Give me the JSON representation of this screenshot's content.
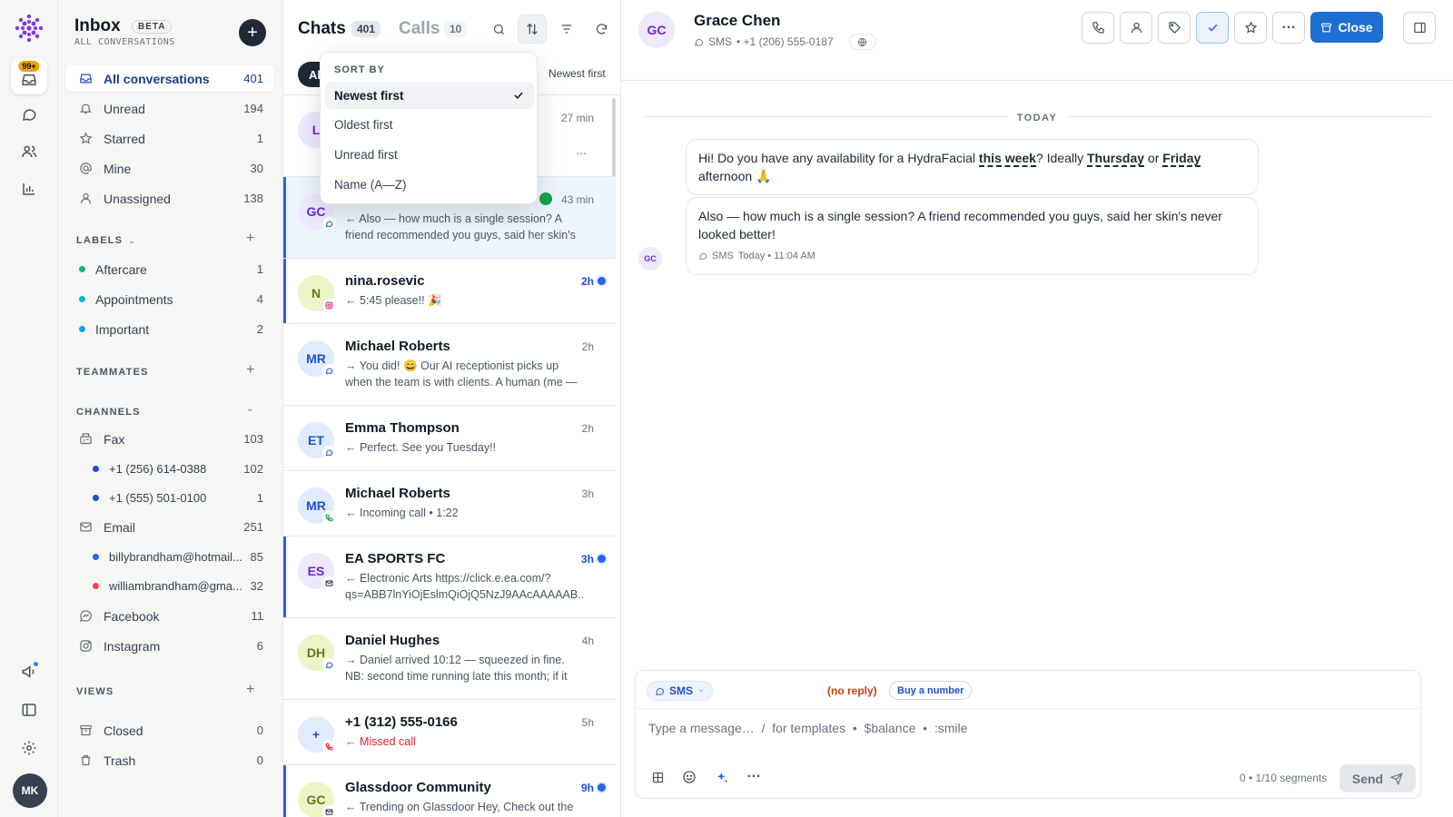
{
  "rail": {
    "badge": "99+",
    "avatar": "MK"
  },
  "sidebar": {
    "title": "Inbox",
    "beta": "BETA",
    "subtitle": "ALL CONVERSATIONS",
    "compose": "+",
    "items": [
      {
        "label": "All conversations",
        "count": "401"
      },
      {
        "label": "Unread",
        "count": "194"
      },
      {
        "label": "Starred",
        "count": "1"
      },
      {
        "label": "Mine",
        "count": "30"
      },
      {
        "label": "Unassigned",
        "count": "138"
      }
    ],
    "labels_header": "LABELS",
    "labels": [
      {
        "label": "Aftercare",
        "count": "1",
        "color": "#10b981"
      },
      {
        "label": "Appointments",
        "count": "4",
        "color": "#06b6d4"
      },
      {
        "label": "Important",
        "count": "2",
        "color": "#0ea5e9"
      }
    ],
    "teammates_header": "TEAMMATES",
    "channels_header": "CHANNELS",
    "channels": {
      "fax": {
        "label": "Fax",
        "count": "103"
      },
      "fax_numbers": [
        {
          "label": "+1 (256) 614-0388",
          "count": "102"
        },
        {
          "label": "+1 (555) 501-0100",
          "count": "1"
        }
      ],
      "email": {
        "label": "Email",
        "count": "251"
      },
      "email_accounts": [
        {
          "label": "billybrandham@hotmail...",
          "count": "85",
          "color": "#2563eb"
        },
        {
          "label": "williambrandham@gma...",
          "count": "32",
          "color": "#ef4444"
        }
      ],
      "facebook": {
        "label": "Facebook",
        "count": "11"
      },
      "instagram": {
        "label": "Instagram",
        "count": "6"
      }
    },
    "views_header": "VIEWS",
    "views": [
      {
        "label": "Closed",
        "count": "0"
      },
      {
        "label": "Trash",
        "count": "0"
      }
    ]
  },
  "list": {
    "chats_label": "Chats",
    "chats_count": "401",
    "calls_label": "Calls",
    "calls_count": "10",
    "filter_all": "All",
    "sort_current": "Newest first",
    "items": [
      {
        "initials": "L",
        "name": "",
        "time": "27 min",
        "preview": "…",
        "avatar_bg": "#ede9fe",
        "avatar_fg": "#6d28d9"
      },
      {
        "initials": "GC",
        "name": "",
        "time": "43 min",
        "preview": "← Also — how much is a single session? A friend recommended you guys, said her skin's never…",
        "avatar_bg": "#ede9fe",
        "avatar_fg": "#6d28d9"
      },
      {
        "initials": "N",
        "name": "nina.rosevic",
        "time": "2h",
        "preview": "← 5:45 please!! 🎉",
        "avatar_bg": "#ecf5c8",
        "avatar_fg": "#65761a"
      },
      {
        "initials": "MR",
        "name": "Michael Roberts",
        "time": "2h",
        "preview": "→ You did! 😄 Our AI receptionist picks up when the team is with clients. A human (me — Sarah!)…",
        "avatar_bg": "#e0ecfd",
        "avatar_fg": "#1d4ed8"
      },
      {
        "initials": "ET",
        "name": "Emma Thompson",
        "time": "2h",
        "preview": "← Perfect. See you Tuesday!!",
        "avatar_bg": "#e0ecfd",
        "avatar_fg": "#1d4ed8"
      },
      {
        "initials": "MR",
        "name": "Michael Roberts",
        "time": "3h",
        "preview": "← Incoming call • 1:22",
        "avatar_bg": "#e0ecfd",
        "avatar_fg": "#1d4ed8"
      },
      {
        "initials": "ES",
        "name": "EA SPORTS FC",
        "time": "3h",
        "preview": "← Electronic Arts https://click.e.ea.com/?qs=ABB7lnYiOjEslmQiOjQ5NzJ9AAcAAAAAB...",
        "avatar_bg": "#ede9fe",
        "avatar_fg": "#6d28d9"
      },
      {
        "initials": "DH",
        "name": "Daniel Hughes",
        "time": "4h",
        "preview": "→ Daniel arrived 10:12 — squeezed in fine. NB: second time running late this month; if it happen...",
        "avatar_bg": "#ecf5c8",
        "avatar_fg": "#65761a"
      },
      {
        "initials": "+",
        "name": "+1 (312) 555-0166",
        "time": "5h",
        "preview": "← Missed call",
        "avatar_bg": "#e0ecfd",
        "avatar_fg": "#1d4ed8"
      },
      {
        "initials": "GC",
        "name": "Glassdoor Community",
        "time": "9h",
        "preview": "← Trending on Glassdoor Hey, Check out the",
        "avatar_bg": "#ecf5c8",
        "avatar_fg": "#65761a"
      }
    ]
  },
  "sort_menu": {
    "header": "SORT BY",
    "options": [
      "Newest first",
      "Oldest first",
      "Unread first",
      "Name (A—Z)"
    ]
  },
  "conversation": {
    "initials": "GC",
    "name": "Grace Chen",
    "channel": "SMS",
    "phone": "• +1 (206) 555-0187",
    "close_label": "Close",
    "day": "TODAY",
    "m1_a": "Hi! Do you have any availability for a HydraFacial ",
    "m1_hl1": "this week",
    "m1_b": "? Ideally ",
    "m1_hl2": "Thursday",
    "m1_c": " or ",
    "m1_hl3": "Friday",
    "m1_d": " afternoon 🙏",
    "m2": "Also — how much is a single session? A friend recommended you guys, said her skin's never looked better!",
    "m2_channel": "SMS",
    "m2_time": "Today • 11:04 AM"
  },
  "composer": {
    "channel": "SMS",
    "no_reply": "(no reply)",
    "buy": "Buy a number",
    "placeholder": "Type a message…  /  for templates  •  $balance  •  :smile",
    "segments": "0 • 1/10 segments",
    "send": "Send"
  },
  "colors": {
    "accent": "#1d6fd1",
    "unread": "#2563eb"
  }
}
